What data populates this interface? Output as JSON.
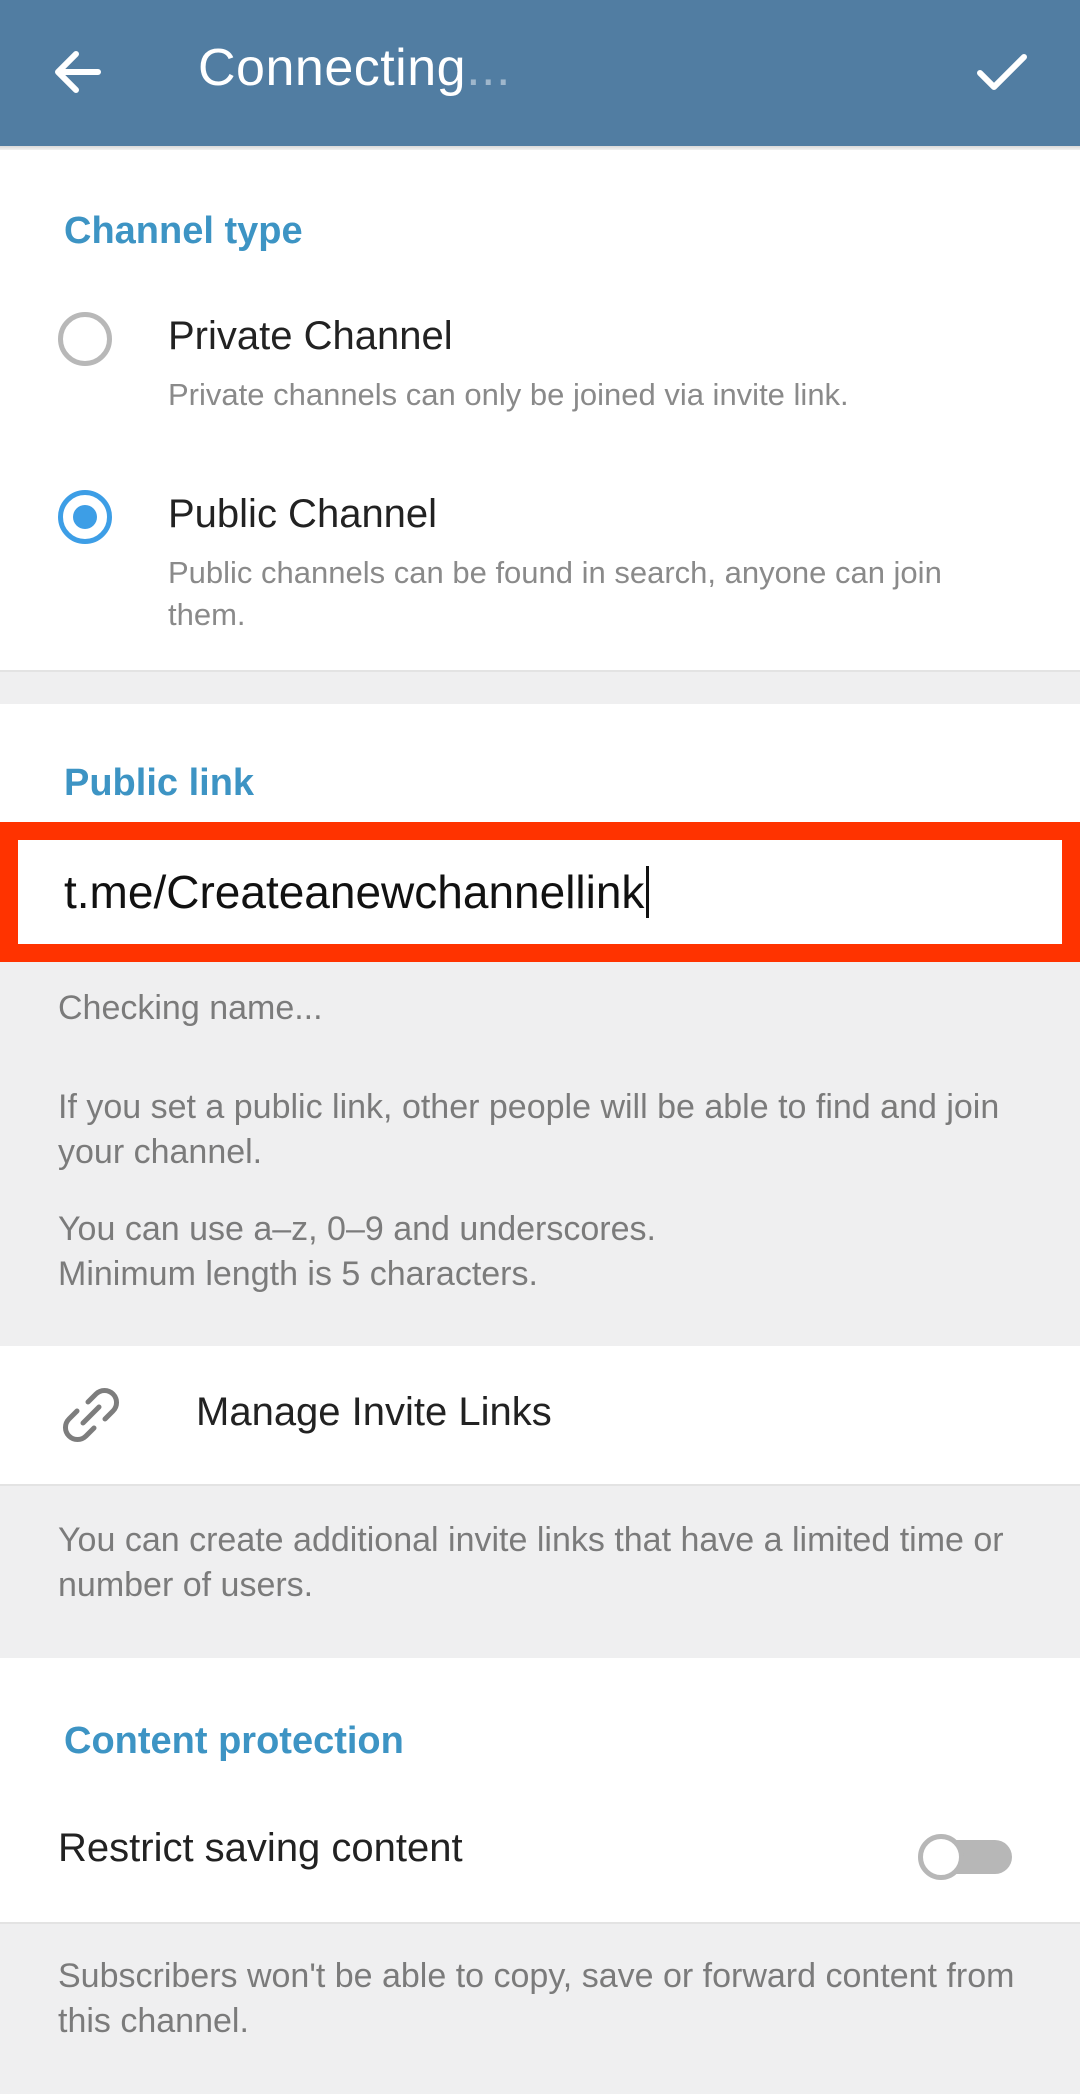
{
  "header": {
    "title": "Connecting",
    "title_dots": "...",
    "back_icon": "arrow-left-icon",
    "confirm_icon": "checkmark-icon"
  },
  "channel_type": {
    "header": "Channel type",
    "options": [
      {
        "title": "Private Channel",
        "description": "Private channels can only be joined via invite link.",
        "selected": false
      },
      {
        "title": "Public Channel",
        "description": "Public channels can be found in search, anyone can join them.",
        "selected": true
      }
    ]
  },
  "public_link": {
    "header": "Public link",
    "value": "t.me/Createanewchannellink",
    "status": "Checking name...",
    "info": "If you set a public link, other people will be able to find and join your channel.",
    "rules_line1": "You can use a–z, 0–9 and underscores.",
    "rules_line2": "Minimum length is 5 characters."
  },
  "invite_links": {
    "label": "Manage Invite Links",
    "icon": "link-icon",
    "description": "You can create additional invite links that have a limited time or number of users."
  },
  "content_protection": {
    "header": "Content protection",
    "toggle_label": "Restrict saving content",
    "toggle_on": false,
    "description": "Subscribers won't be able to copy, save or forward content from this channel."
  },
  "colors": {
    "header_bg": "#517da2",
    "accent": "#3d94c4",
    "radio_selected": "#3d9ee6",
    "highlight_box": "#ff3300"
  }
}
